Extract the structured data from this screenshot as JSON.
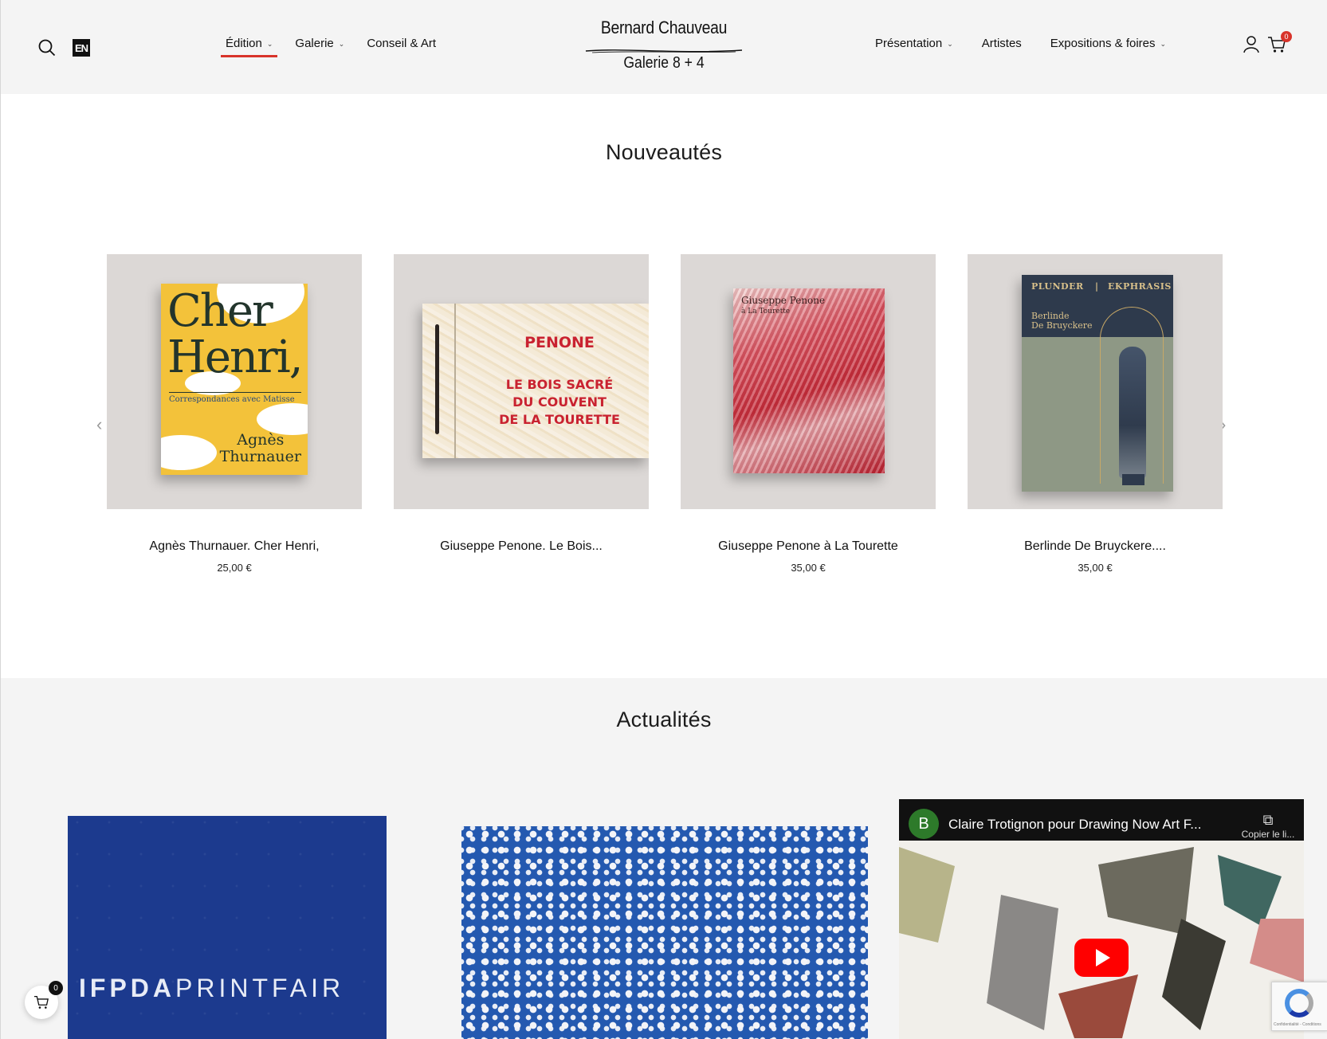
{
  "header": {
    "lang_label": "EN",
    "nav_left": [
      {
        "label": "Édition",
        "has_dropdown": true,
        "active": true
      },
      {
        "label": "Galerie",
        "has_dropdown": true
      },
      {
        "label": "Conseil & Art",
        "has_dropdown": false
      }
    ],
    "logo": {
      "line1": "Bernard Chauveau",
      "line2": "Galerie 8 + 4"
    },
    "nav_right": [
      {
        "label": "Présentation",
        "has_dropdown": true
      },
      {
        "label": "Artistes",
        "has_dropdown": false
      },
      {
        "label": "Expositions & foires",
        "has_dropdown": true
      }
    ],
    "cart_count": "0",
    "accent_color": "#d8332a"
  },
  "nouveautes": {
    "title": "Nouveautés",
    "prev_icon": "chevron-left-icon",
    "next_icon": "chevron-right-icon",
    "products": [
      {
        "name": "Agnès Thurnauer. Cher Henri,",
        "price": "25,00 €",
        "cover": {
          "title": "Cher Henri,",
          "subtitle": "Correspondances avec Matisse",
          "author_l1": "Agnès",
          "author_l2": "Thurnauer"
        }
      },
      {
        "name": "Giuseppe Penone. Le Bois...",
        "price": "",
        "cover": {
          "title": "PENONE",
          "l1": "LE BOIS SACRÉ",
          "l2": "DU COUVENT",
          "l3": "DE LA TOURETTE"
        }
      },
      {
        "name": "Giuseppe Penone à La Tourette",
        "price": "35,00 €",
        "cover": {
          "title": "Giuseppe Penone",
          "subtitle": "à La Tourette"
        }
      },
      {
        "name": "Berlinde De Bruyckere....",
        "price": "35,00 €",
        "cover": {
          "h_left": "PLUNDER",
          "h_sep": "|",
          "h_right": "EKPHRASIS",
          "author_l1": "Berlinde",
          "author_l2": "De Bruyckere"
        }
      }
    ]
  },
  "actualites": {
    "title": "Actualités",
    "news1": {
      "bold": "IFPDA",
      "light": "PRINTFAIR"
    },
    "video": {
      "avatar_letter": "B",
      "title": "Claire Trotignon pour Drawing Now Art F...",
      "copy_label": "Copier le li..."
    }
  },
  "recaptcha": {
    "text": "Confidentialité - Conditions"
  },
  "floating_cart": {
    "count": "0"
  }
}
